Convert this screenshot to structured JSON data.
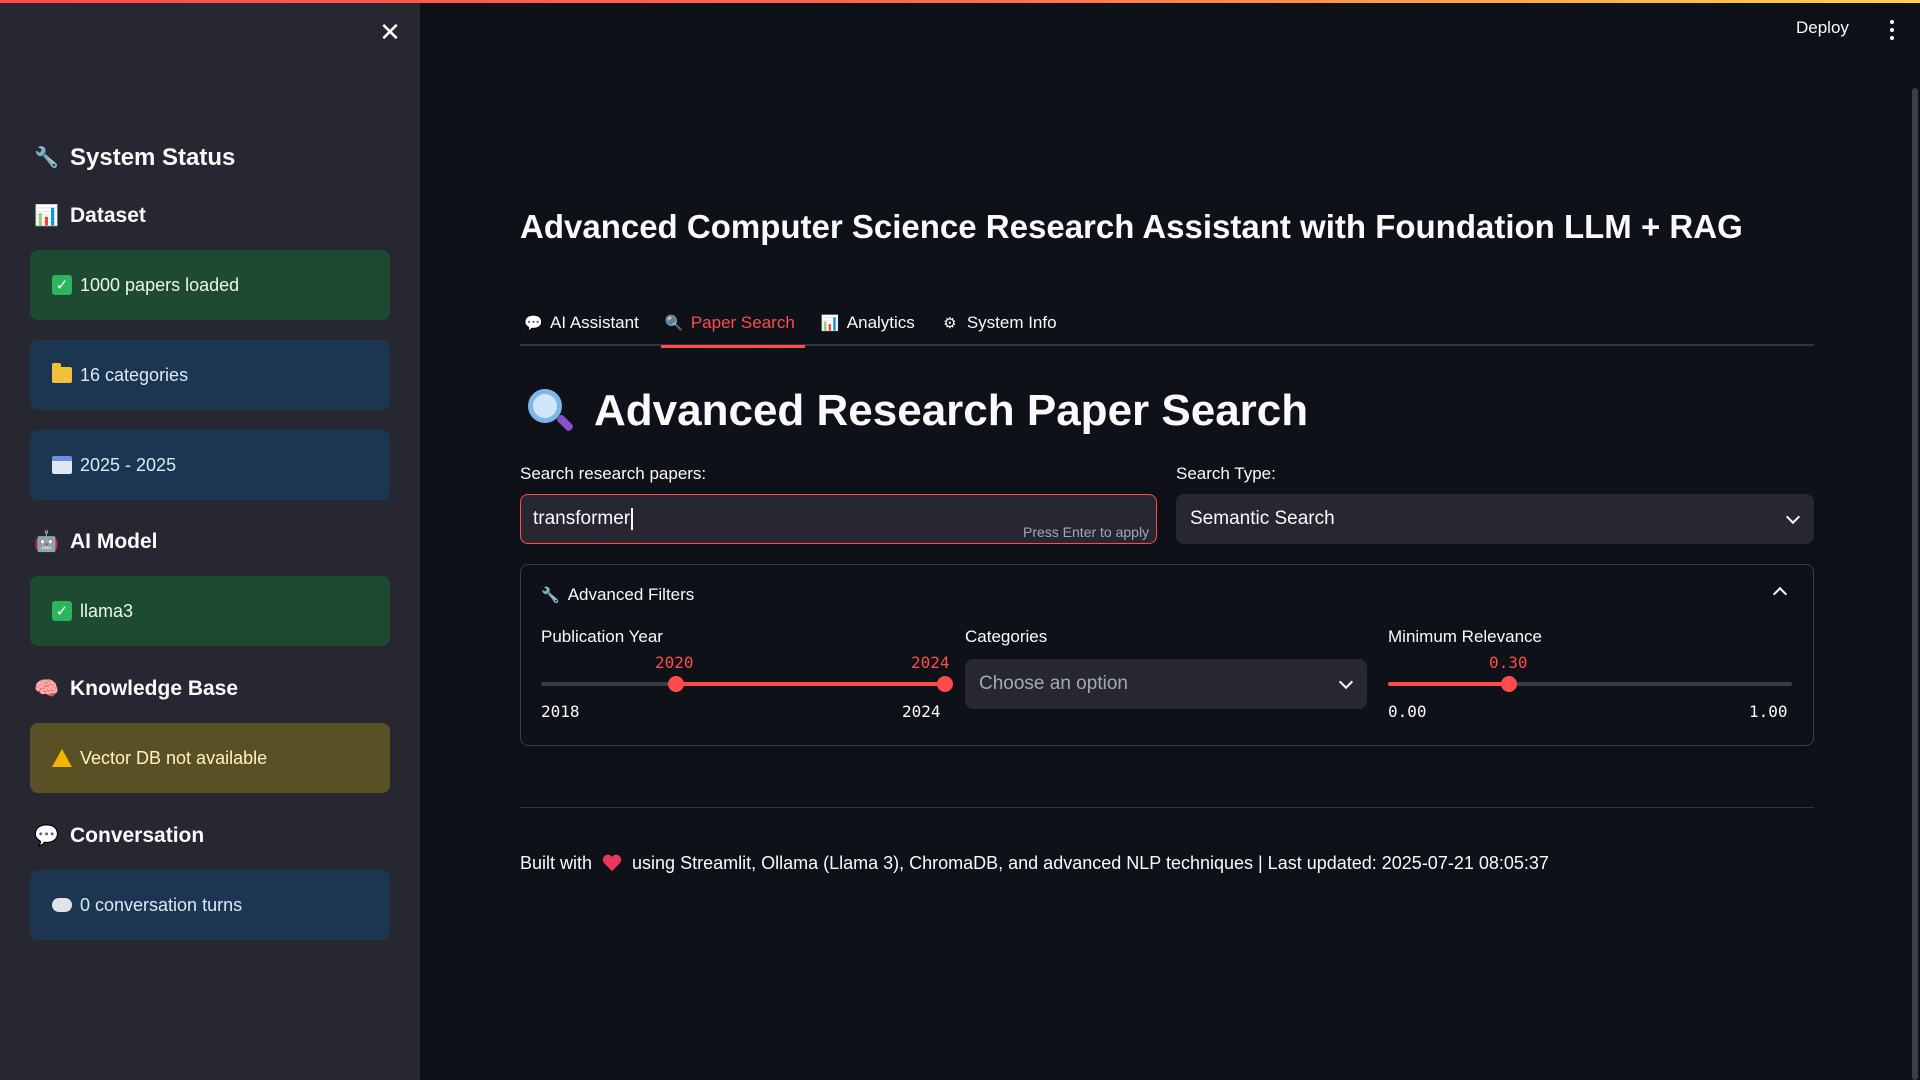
{
  "sidebar": {
    "close_icon": "close-icon",
    "system_status": "System Status",
    "dataset_heading": "Dataset",
    "dataset_loaded": "1000 papers loaded",
    "dataset_categories": "16 categories",
    "dataset_years": "2025 - 2025",
    "ai_model_heading": "AI Model",
    "ai_model_name": "llama3",
    "knowledge_heading": "Knowledge Base",
    "vector_db_status": "Vector DB not available",
    "conversation_heading": "Conversation",
    "conversation_turns": "0 conversation turns"
  },
  "header": {
    "deploy_label": "Deploy",
    "accent_color": "#ff4b4b"
  },
  "main": {
    "title": "Advanced Computer Science Research Assistant with Foundation LLM + RAG",
    "tabs": [
      {
        "label": "AI Assistant",
        "icon": "speech-bubble-icon"
      },
      {
        "label": "Paper Search",
        "icon": "magnifier-icon",
        "active": true
      },
      {
        "label": "Analytics",
        "icon": "bar-chart-icon"
      },
      {
        "label": "System Info",
        "icon": "gear-icon"
      }
    ],
    "section_title": "Advanced Research Paper Search",
    "search_label": "Search research papers:",
    "search_value": "transformer",
    "search_hint": "Press Enter to apply",
    "search_type_label": "Search Type:",
    "search_type_value": "Semantic Search",
    "filters": {
      "header": "Advanced Filters",
      "pub_year_label": "Publication Year",
      "pub_year_low": "2020",
      "pub_year_high": "2024",
      "pub_year_min": "2018",
      "pub_year_max": "2024",
      "categories_label": "Categories",
      "categories_placeholder": "Choose an option",
      "relevance_label": "Minimum Relevance",
      "relevance_value": "0.30",
      "relevance_min": "0.00",
      "relevance_max": "1.00"
    },
    "footer_prefix": "Built with",
    "footer_suffix": "using Streamlit, Ollama (Llama 3), ChromaDB, and advanced NLP techniques | Last updated: 2025-07-21 08:05:37"
  }
}
